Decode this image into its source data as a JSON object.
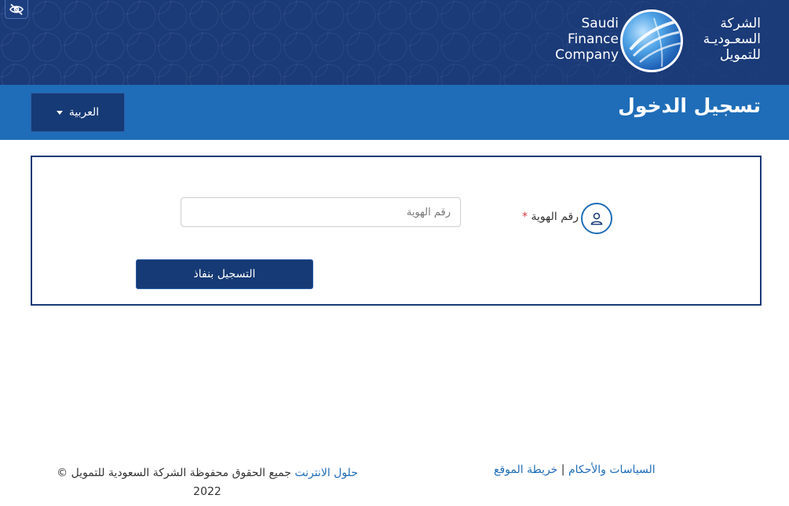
{
  "header": {
    "accessibility_icon": "eye-slash-icon",
    "logo": {
      "en_lines": [
        "Saudi",
        "Finance",
        "Company"
      ],
      "ar_lines": [
        "الشركة",
        "السعـوديـة",
        "للتمويل"
      ]
    }
  },
  "titlebar": {
    "title": "تسجيل الدخول",
    "language_button": "العربية"
  },
  "form": {
    "id_label": "رقم الهوية",
    "required_mark": "*",
    "id_input_placeholder": "رقم الهوية",
    "id_input_value": "",
    "user_icon": "user-icon",
    "nafath_button": "التسجيل بنفاذ"
  },
  "footer": {
    "policies_link": "السياسات والأحكام",
    "separator": "|",
    "sitemap_link": "خريطة الموقع",
    "internet_solutions_link": "حلول الانترنت",
    "copyright_text": "جميع الحقوق محفوظة الشركة السعودية للتمويل ©",
    "year": "2022"
  },
  "colors": {
    "banner": "#1a3a78",
    "titlebar": "#1f6db8",
    "button": "#163a75",
    "link": "#1f6db8",
    "required": "#d9363e"
  }
}
